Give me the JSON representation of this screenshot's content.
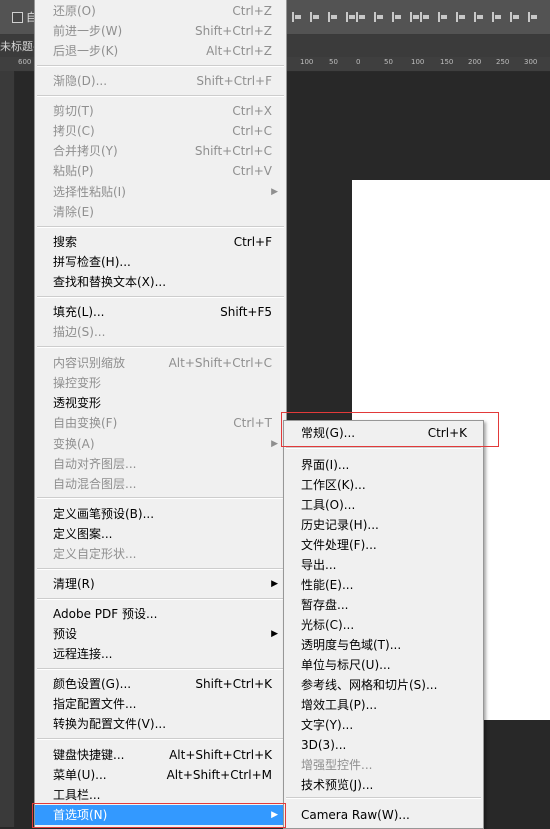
{
  "background": {
    "options_bar_text": "自",
    "doc_tab_title": "未标题-",
    "ruler_numbers": [
      "600",
      "100",
      "50",
      "0",
      "50",
      "100",
      "150",
      "200",
      "250",
      "300"
    ]
  },
  "edit_menu": {
    "items": [
      {
        "label": "还原(O)",
        "shortcut": "Ctrl+Z",
        "disabled": true
      },
      {
        "label": "前进一步(W)",
        "shortcut": "Shift+Ctrl+Z",
        "disabled": true
      },
      {
        "label": "后退一步(K)",
        "shortcut": "Alt+Ctrl+Z",
        "disabled": true
      },
      {
        "label": "渐隐(D)...",
        "shortcut": "Shift+Ctrl+F",
        "disabled": true
      },
      {
        "label": "剪切(T)",
        "shortcut": "Ctrl+X",
        "disabled": true
      },
      {
        "label": "拷贝(C)",
        "shortcut": "Ctrl+C",
        "disabled": true
      },
      {
        "label": "合并拷贝(Y)",
        "shortcut": "Shift+Ctrl+C",
        "disabled": true
      },
      {
        "label": "粘贴(P)",
        "shortcut": "Ctrl+V",
        "disabled": true
      },
      {
        "label": "选择性粘贴(I)",
        "shortcut": "",
        "disabled": true
      },
      {
        "label": "清除(E)",
        "shortcut": "",
        "disabled": true
      },
      {
        "label": "搜索",
        "shortcut": "Ctrl+F",
        "disabled": false
      },
      {
        "label": "拼写检查(H)...",
        "shortcut": "",
        "disabled": false
      },
      {
        "label": "查找和替换文本(X)...",
        "shortcut": "",
        "disabled": false
      },
      {
        "label": "填充(L)...",
        "shortcut": "Shift+F5",
        "disabled": false
      },
      {
        "label": "描边(S)...",
        "shortcut": "",
        "disabled": true
      },
      {
        "label": "内容识别缩放",
        "shortcut": "Alt+Shift+Ctrl+C",
        "disabled": true
      },
      {
        "label": "操控变形",
        "shortcut": "",
        "disabled": true
      },
      {
        "label": "透视变形",
        "shortcut": "",
        "disabled": false
      },
      {
        "label": "自由变换(F)",
        "shortcut": "Ctrl+T",
        "disabled": true
      },
      {
        "label": "变换(A)",
        "shortcut": "",
        "disabled": true
      },
      {
        "label": "自动对齐图层...",
        "shortcut": "",
        "disabled": true
      },
      {
        "label": "自动混合图层...",
        "shortcut": "",
        "disabled": true
      },
      {
        "label": "定义画笔预设(B)...",
        "shortcut": "",
        "disabled": false
      },
      {
        "label": "定义图案...",
        "shortcut": "",
        "disabled": false
      },
      {
        "label": "定义自定形状...",
        "shortcut": "",
        "disabled": true
      },
      {
        "label": "清理(R)",
        "shortcut": "",
        "disabled": false
      },
      {
        "label": "Adobe PDF 预设...",
        "shortcut": "",
        "disabled": false
      },
      {
        "label": "预设",
        "shortcut": "",
        "disabled": false
      },
      {
        "label": "远程连接...",
        "shortcut": "",
        "disabled": false
      },
      {
        "label": "颜色设置(G)...",
        "shortcut": "Shift+Ctrl+K",
        "disabled": false
      },
      {
        "label": "指定配置文件...",
        "shortcut": "",
        "disabled": false
      },
      {
        "label": "转换为配置文件(V)...",
        "shortcut": "",
        "disabled": false
      },
      {
        "label": "键盘快捷键...",
        "shortcut": "Alt+Shift+Ctrl+K",
        "disabled": false
      },
      {
        "label": "菜单(U)...",
        "shortcut": "Alt+Shift+Ctrl+M",
        "disabled": false
      },
      {
        "label": "工具栏...",
        "shortcut": "",
        "disabled": false
      },
      {
        "label": "首选项(N)",
        "shortcut": "",
        "disabled": false
      }
    ]
  },
  "preferences_submenu": {
    "items": [
      {
        "label": "常规(G)...",
        "shortcut": "Ctrl+K",
        "disabled": false
      },
      {
        "label": "界面(I)...",
        "shortcut": "",
        "disabled": false
      },
      {
        "label": "工作区(K)...",
        "shortcut": "",
        "disabled": false
      },
      {
        "label": "工具(O)...",
        "shortcut": "",
        "disabled": false
      },
      {
        "label": "历史记录(H)...",
        "shortcut": "",
        "disabled": false
      },
      {
        "label": "文件处理(F)...",
        "shortcut": "",
        "disabled": false
      },
      {
        "label": "导出...",
        "shortcut": "",
        "disabled": false
      },
      {
        "label": "性能(E)...",
        "shortcut": "",
        "disabled": false
      },
      {
        "label": "暂存盘...",
        "shortcut": "",
        "disabled": false
      },
      {
        "label": "光标(C)...",
        "shortcut": "",
        "disabled": false
      },
      {
        "label": "透明度与色域(T)...",
        "shortcut": "",
        "disabled": false
      },
      {
        "label": "单位与标尺(U)...",
        "shortcut": "",
        "disabled": false
      },
      {
        "label": "参考线、网格和切片(S)...",
        "shortcut": "",
        "disabled": false
      },
      {
        "label": "增效工具(P)...",
        "shortcut": "",
        "disabled": false
      },
      {
        "label": "文字(Y)...",
        "shortcut": "",
        "disabled": false
      },
      {
        "label": "3D(3)...",
        "shortcut": "",
        "disabled": false
      },
      {
        "label": "增强型控件...",
        "shortcut": "",
        "disabled": true
      },
      {
        "label": "技术预览(J)...",
        "shortcut": "",
        "disabled": false
      },
      {
        "label": "Camera Raw(W)...",
        "shortcut": "",
        "disabled": false
      }
    ]
  },
  "colors": {
    "highlight": "#3399ff",
    "annotation_red": "#e23a3a",
    "disabled_text": "#8f8f8f"
  }
}
